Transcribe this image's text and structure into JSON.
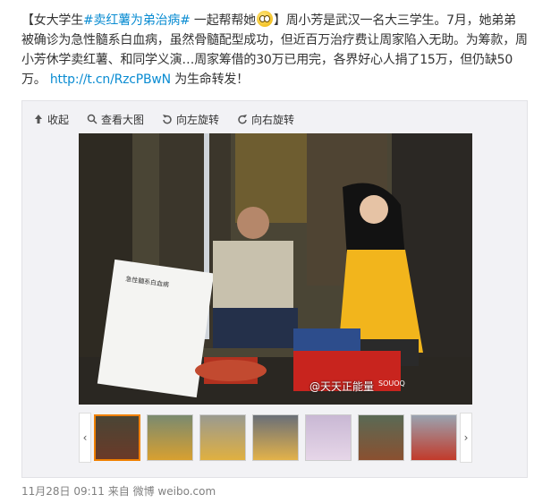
{
  "post": {
    "bracket_open": "【女大学生",
    "tag1": "#卖红薯为弟治病#",
    "phrase": " 一起帮帮她",
    "bracket_close": "】",
    "body": "周小芳是武汉一名大三学生。7月，她弟弟被确诊为急性髓系白血病，虽然骨髓配型成功，但近百万治疗费让周家陷入无助。为筹款，周小芳休学卖红薯、和同学义演…周家筹借的30万已用完，各界好心人捐了15万，但仍缺50万。",
    "url": "http://t.cn/RzcPBwN",
    "tail": " 为生命转发！"
  },
  "toolbar": {
    "collapse": "收起",
    "view_large": "查看大图",
    "rotate_left": "向左旋转",
    "rotate_right": "向右旋转"
  },
  "photo": {
    "watermark": "@天天正能量",
    "sign_text": "急性髓系白血病"
  },
  "thumbnails": {
    "count": 8,
    "active_index": 0
  },
  "footer": {
    "date": "11月28日 09:11",
    "from": "来自",
    "source": "微博 weibo.com"
  },
  "colors": {
    "link": "#0a8cd2",
    "active_thumb": "#f08000",
    "jacket": "#f2b51c"
  }
}
